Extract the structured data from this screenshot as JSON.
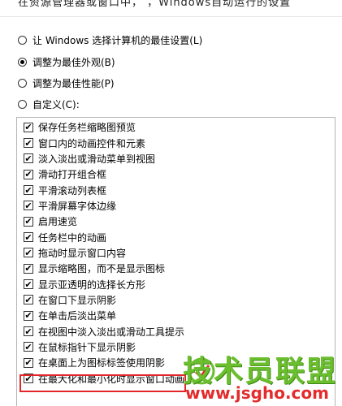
{
  "top_fragment": "在资源管理器或窗口中，     ，Windows自动运行的设置",
  "radio_options": [
    {
      "label": "让 Windows 选择计算机的最佳设置(L)",
      "checked": false
    },
    {
      "label": "调整为最佳外观(B)",
      "checked": true
    },
    {
      "label": "调整为最佳性能(P)",
      "checked": false
    },
    {
      "label": "自定义(C):",
      "checked": false
    }
  ],
  "checkbox_items": [
    {
      "label": "保存任务栏缩略图预览",
      "checked": true
    },
    {
      "label": "窗口内的动画控件和元素",
      "checked": true
    },
    {
      "label": "淡入淡出或滑动菜单到视图",
      "checked": true
    },
    {
      "label": "滑动打开组合框",
      "checked": true
    },
    {
      "label": "平滑滚动列表框",
      "checked": true
    },
    {
      "label": "平滑屏幕字体边缘",
      "checked": true
    },
    {
      "label": "启用速览",
      "checked": true
    },
    {
      "label": "任务栏中的动画",
      "checked": true
    },
    {
      "label": "拖动时显示窗口内容",
      "checked": true
    },
    {
      "label": "显示缩略图，而不是显示图标",
      "checked": true
    },
    {
      "label": "显示亚透明的选择长方形",
      "checked": true
    },
    {
      "label": "在窗口下显示阴影",
      "checked": true
    },
    {
      "label": "在单击后淡出菜单",
      "checked": true
    },
    {
      "label": "在视图中淡入淡出或滑动工具提示",
      "checked": true
    },
    {
      "label": "在鼠标指针下显示阴影",
      "checked": true
    },
    {
      "label": "在桌面上为图标标签使用阴影",
      "checked": true
    },
    {
      "label": "在最大化和最小化时显示窗口动画",
      "checked": true
    }
  ],
  "checkmark_glyph": "✔",
  "watermark": {
    "title": "技术员联盟",
    "url": "www.jsgho.com"
  },
  "colors": {
    "highlight_border": "#e3262a",
    "watermark_green": "#6bbf2e",
    "watermark_red": "#e32b2b"
  }
}
